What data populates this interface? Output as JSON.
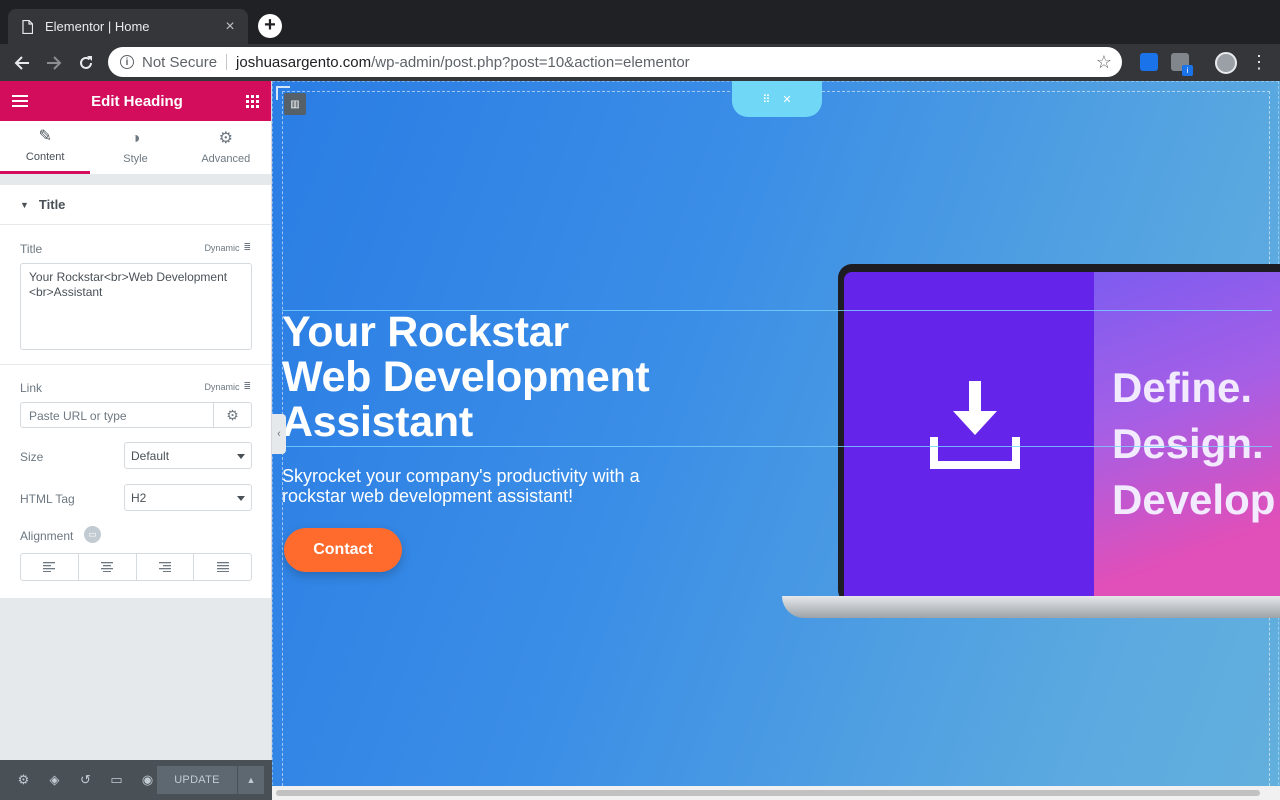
{
  "browser": {
    "tab_title": "Elementor | Home",
    "new_tab_symbol": "+",
    "tab_close_symbol": "×",
    "security_label": "Not Secure",
    "url_host": "joshuasargento.com",
    "url_path": "/wp-admin/post.php?post=10&action=elementor",
    "ext_badge": "i"
  },
  "panel": {
    "header_title": "Edit Heading",
    "tabs": [
      {
        "label": "Content",
        "icon": "pencil-icon",
        "active": true
      },
      {
        "label": "Style",
        "icon": "contrast-icon",
        "active": false
      },
      {
        "label": "Advanced",
        "icon": "gear-icon",
        "active": false
      }
    ],
    "section_title": "Title",
    "title_label": "Title",
    "dynamic_label": "Dynamic",
    "title_value": "Your Rockstar<br>Web Development <br>Assistant",
    "link_label": "Link",
    "link_placeholder": "Paste URL or type",
    "size_label": "Size",
    "size_value": "Default",
    "html_tag_label": "HTML Tag",
    "html_tag_value": "H2",
    "alignment_label": "Alignment",
    "footer_update_label": "UPDATE"
  },
  "canvas": {
    "heading_line1": "Your Rockstar",
    "heading_line2": "Web Development",
    "heading_line3": "Assistant",
    "subtext": "Skyrocket your company's productivity with a rockstar web development assistant!",
    "contact_label": "Contact",
    "screen_line1": "Define.",
    "screen_line2": "Design.",
    "screen_line3": "Develop",
    "colors": {
      "accent": "#d30c5c",
      "button": "#ff6b2c",
      "hero_blue": "#2a7de4"
    }
  }
}
